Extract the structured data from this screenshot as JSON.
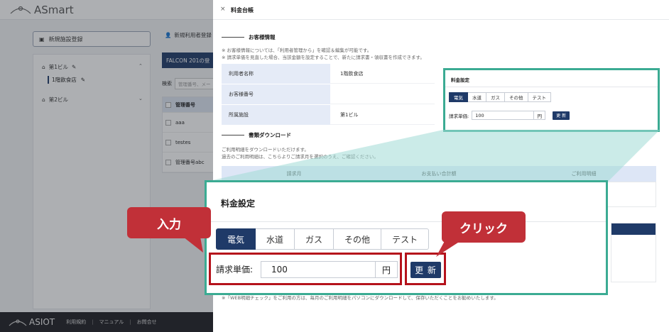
{
  "app": {
    "logo_text": "ASmart",
    "new_facility_label": "新規施設登録",
    "tree": {
      "building1": "第1ビル",
      "building1_child": "1階飲食店",
      "building2": "第2ビル"
    },
    "new_user_label": "新規利用者登録",
    "falcon_tab": "FALCON 201の登",
    "search_label": "検索",
    "search_placeholder": "管理番号、メー",
    "user_table": {
      "header": "管理番号",
      "rows": [
        "aaa",
        "testes",
        "管理番号abc"
      ]
    },
    "footer": {
      "logo": "ASIOT",
      "links": [
        "利用規約",
        "マニュアル",
        "お問合せ"
      ]
    }
  },
  "drawer": {
    "close": "×",
    "title": "料金台帳",
    "customer_section": "お客様情報",
    "customer_notes": [
      "※ お客様情報については、「利用者管理から」を確認＆編集が可能です。",
      "※ 請求単価を見直した場合、当該金額を設定することで、新たに請求書・領収書を作成できます。"
    ],
    "info_rows": [
      {
        "label": "利用者名称",
        "value": "1階飲食店"
      },
      {
        "label": "お客様番号",
        "value": ""
      },
      {
        "label": "所属施設",
        "value": "第1ビル"
      }
    ],
    "download_section": "書類ダウンロード",
    "download_notes": [
      "ご利用明細をダウンロードいただけます。",
      "過去のご利用明細は、こちらよりご請求月を選択のうえ、ご確認ください。"
    ],
    "download_columns": [
      "請求月",
      "お支払い合計額",
      "ご利用明細"
    ],
    "bottom_note": "※「WEB明細チェック」をご利用の方は、毎月のご利用明細をパソコンにダウンロードして、保存いただくことをお勧めいたします。"
  },
  "pricing": {
    "title": "料金設定",
    "tabs": [
      "電気",
      "水道",
      "ガス",
      "その他",
      "テスト"
    ],
    "active_tab": "電気",
    "price_label": "請求単価:",
    "price_value": "100",
    "unit": "円",
    "update_label": "更 新"
  },
  "callouts": {
    "input": "入力",
    "click": "クリック"
  },
  "colors": {
    "navy": "#1f3a68",
    "teal_frame": "#3bab93",
    "red_frame": "#b5121b",
    "callout": "#c13038"
  }
}
